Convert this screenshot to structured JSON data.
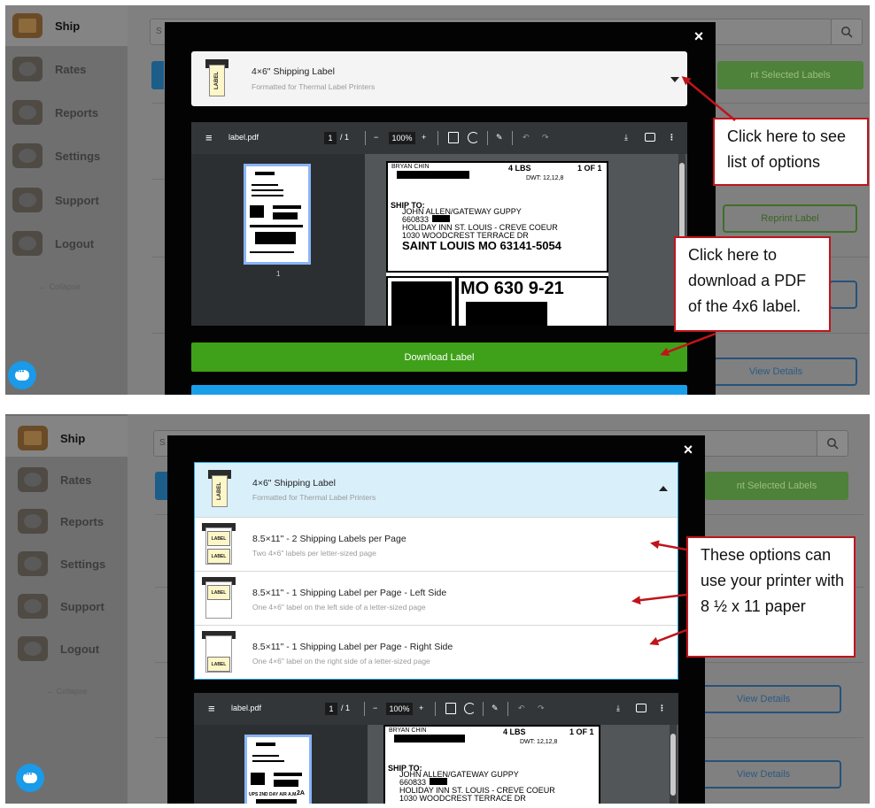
{
  "sidebar": {
    "items": [
      {
        "label": "Ship",
        "icon": "box-icon"
      },
      {
        "label": "Rates",
        "icon": "coins-icon"
      },
      {
        "label": "Reports",
        "icon": "reports-icon"
      },
      {
        "label": "Settings",
        "icon": "gear-icon"
      },
      {
        "label": "Support",
        "icon": "lifebuoy-icon"
      },
      {
        "label": "Logout",
        "icon": "logout-icon"
      }
    ],
    "collapse_label": "← Collapse"
  },
  "search": {
    "placeholder": "S"
  },
  "background": {
    "print_selected_label": "nt Selected Labels",
    "reprint_label": "Reprint Label",
    "view_details": "View Details"
  },
  "modal": {
    "close": "×",
    "selected_option": {
      "thumb_text": "LABEL",
      "title": "4×6\" Shipping Label",
      "subtitle": "Formatted for Thermal Label Printers"
    },
    "options": [
      {
        "title": "8.5×11\" - 2 Shipping Labels per Page",
        "subtitle": "Two 4×6\" labels per letter-sized page",
        "thumb_text": "LABEL"
      },
      {
        "title": "8.5×11\" - 1 Shipping Label per Page - Left Side",
        "subtitle": "One 4×6\" label on the left side of a letter-sized page",
        "thumb_text": "LABEL"
      },
      {
        "title": "8.5×11\" - 1 Shipping Label per Page - Right Side",
        "subtitle": "One 4×6\" label on the right side of a letter-sized page",
        "thumb_text": "LABEL"
      }
    ],
    "download_label": "Download Label"
  },
  "pdf_viewer": {
    "menu_icon": "≡",
    "filename": "label.pdf",
    "page_current": "1",
    "page_total": "/ 1",
    "zoom_out": "−",
    "zoom": "100%",
    "zoom_in": "+",
    "thumb_page_number": "1",
    "icons": [
      "fit-page-icon",
      "rotate-icon",
      "annotate-icon",
      "undo-icon",
      "redo-icon",
      "download-icon",
      "print-icon",
      "more-icon"
    ]
  },
  "shipping_label": {
    "sender": "BRYAN CHIN",
    "weight": "4 LBS",
    "count": "1 OF 1",
    "dwt": "DWT: 12,12,8",
    "ship_to_heading": "SHIP TO:",
    "recipient_line1": "JOHN ALLEN/GATEWAY GUPPY",
    "recipient_phone": "660833",
    "recipient_line2": "HOLIDAY INN ST. LOUIS - CREVE COEUR",
    "recipient_line3": "1030 WOODCREST TERRACE DR",
    "recipient_city": "SAINT LOUIS  MO  63141-5054",
    "routing_code": "MO 630 9-21",
    "thumb_service": "UPS 2ND DAY AIR A.M.",
    "thumb_service_code": "2A"
  },
  "callouts": {
    "options": "Click here to see list of options",
    "download": "Click here to download a PDF of the 4x6 label.",
    "paper": "These options can use your printer with 8 ½ x 11 paper"
  },
  "colors": {
    "accent_red": "#c0141b",
    "download_green": "#3fa119",
    "chat_blue": "#1a9ae8",
    "selected_blue": "#d9f0fb"
  }
}
